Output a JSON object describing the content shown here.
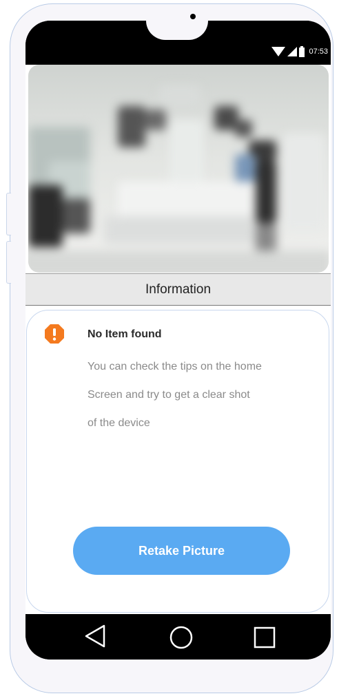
{
  "status_bar": {
    "time": "07:53",
    "icons": [
      "wifi-icon",
      "signal-icon",
      "battery-icon"
    ]
  },
  "photo": {
    "description_icon": "blurred-camera-preview"
  },
  "info_header": {
    "title": "Information"
  },
  "message": {
    "icon": "warning-octagon-icon",
    "title": "No Item found",
    "lines": [
      "You can check the tips on the home",
      "Screen and try to get a clear shot",
      "of the device"
    ]
  },
  "actions": {
    "retake_label": "Retake Picture"
  },
  "nav_bar": {
    "icons": [
      "back-icon",
      "home-icon",
      "recents-icon"
    ]
  },
  "colors": {
    "accent": "#5aaaf2",
    "warning": "#f47a1f",
    "header_bg": "#e8e8e8"
  }
}
